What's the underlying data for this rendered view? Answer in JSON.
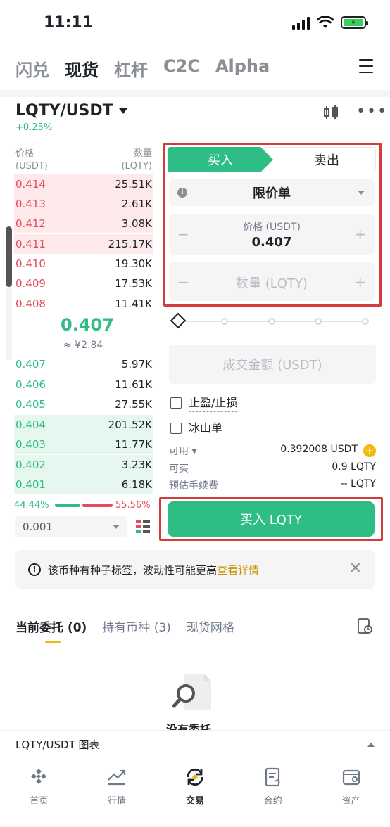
{
  "status_bar": {
    "time": "11:11"
  },
  "top_tabs": [
    {
      "label": "闪兑",
      "active": false
    },
    {
      "label": "现货",
      "active": true
    },
    {
      "label": "杠杆",
      "active": false
    },
    {
      "label": "C2C",
      "active": false
    },
    {
      "label": "Alpha",
      "active": false
    }
  ],
  "market": {
    "pair": "LQTY/USDT",
    "change": "+0.25%"
  },
  "orderbook": {
    "price_header": "价格",
    "price_unit": "(USDT)",
    "qty_header": "数量",
    "qty_unit": "(LQTY)",
    "asks": [
      {
        "price": "0.414",
        "qty": "25.51K",
        "depth": 1.0
      },
      {
        "price": "0.413",
        "qty": "2.61K",
        "depth": 1.0
      },
      {
        "price": "0.412",
        "qty": "3.08K",
        "depth": 1.0
      },
      {
        "price": "0.411",
        "qty": "215.17K",
        "depth": 1.0
      },
      {
        "price": "0.410",
        "qty": "19.30K",
        "depth": 0
      },
      {
        "price": "0.409",
        "qty": "17.53K",
        "depth": 0
      },
      {
        "price": "0.408",
        "qty": "11.41K",
        "depth": 0
      }
    ],
    "last_price": "0.407",
    "last_price_cny": "≈ ¥2.84",
    "bids": [
      {
        "price": "0.407",
        "qty": "5.97K",
        "depth": 0
      },
      {
        "price": "0.406",
        "qty": "11.61K",
        "depth": 0
      },
      {
        "price": "0.405",
        "qty": "27.55K",
        "depth": 0
      },
      {
        "price": "0.404",
        "qty": "201.52K",
        "depth": 1.0
      },
      {
        "price": "0.403",
        "qty": "11.77K",
        "depth": 1.0
      },
      {
        "price": "0.402",
        "qty": "3.23K",
        "depth": 1.0
      },
      {
        "price": "0.401",
        "qty": "6.18K",
        "depth": 1.0
      }
    ],
    "buy_ratio": "44.44%",
    "sell_ratio": "55.56%",
    "depth_precision": "0.001"
  },
  "order_form": {
    "buy_label": "买入",
    "sell_label": "卖出",
    "order_type": "限价单",
    "price_label": "价格 (USDT)",
    "price_value": "0.407",
    "qty_placeholder": "数量 (LQTY)",
    "amount_placeholder": "成交金额 (USDT)",
    "tp_sl_label": "止盈/止损",
    "iceberg_label": "冰山单",
    "available_label": "可用",
    "available_value": "0.392008 USDT",
    "can_buy_label": "可买",
    "can_buy_value": "0.9 LQTY",
    "fee_label": "预估手续费",
    "fee_value": "-- LQTY",
    "submit_label": "买入 LQTY"
  },
  "notice": {
    "text": "该币种有种子标签，波动性可能更高",
    "link": "查看详情"
  },
  "orders_tabs": [
    {
      "label": "当前委托 (0)",
      "active": true
    },
    {
      "label": "持有币种 (3)",
      "active": false
    },
    {
      "label": "现货网格",
      "active": false
    }
  ],
  "empty_state": "没有委托",
  "chart_bar": {
    "label": "LQTY/USDT 图表"
  },
  "bottom_nav": [
    {
      "label": "首页",
      "icon": "home-icon",
      "active": false
    },
    {
      "label": "行情",
      "icon": "markets-icon",
      "active": false
    },
    {
      "label": "交易",
      "icon": "trade-icon",
      "active": true
    },
    {
      "label": "合约",
      "icon": "futures-icon",
      "active": false
    },
    {
      "label": "资产",
      "icon": "wallet-icon",
      "active": false
    }
  ],
  "colors": {
    "buy_green": "#2ebd85",
    "sell_red": "#e64a5c",
    "accent_yellow": "#f0b90b",
    "highlight_box": "#d63a3a"
  }
}
